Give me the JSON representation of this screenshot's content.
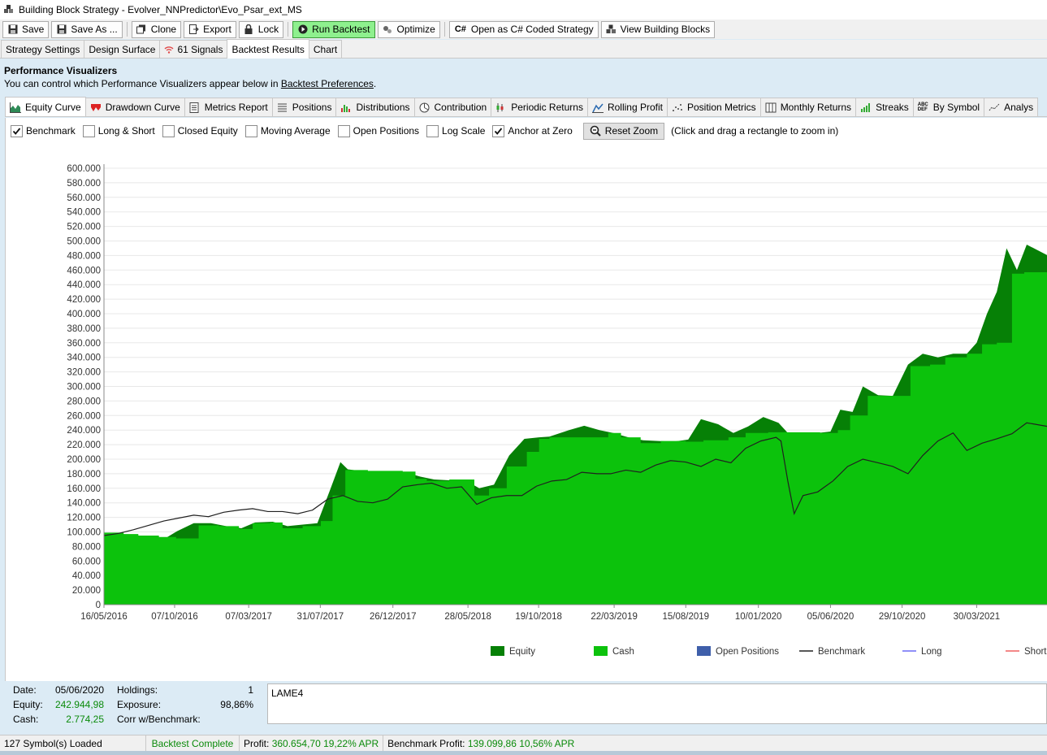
{
  "window": {
    "title": "Building Block Strategy - Evolver_NNPredictor\\Evo_Psar_ext_MS"
  },
  "toolbar": {
    "save": "Save",
    "save_as": "Save As ...",
    "clone": "Clone",
    "export": "Export",
    "lock": "Lock",
    "run_backtest": "Run Backtest",
    "optimize": "Optimize",
    "open_csharp": "Open as C# Coded Strategy",
    "view_blocks": "View Building Blocks"
  },
  "tabs": {
    "strategy_settings": "Strategy Settings",
    "design_surface": "Design Surface",
    "signals": "61 Signals",
    "backtest_results": "Backtest Results",
    "chart": "Chart"
  },
  "perf": {
    "heading": "Performance Visualizers",
    "sub_prefix": "You can control which Performance Visualizers appear below in ",
    "sub_link": "Backtest Preferences",
    "sub_suffix": "."
  },
  "visualizers": {
    "equity_curve": "Equity Curve",
    "drawdown_curve": "Drawdown Curve",
    "metrics_report": "Metrics Report",
    "positions": "Positions",
    "distributions": "Distributions",
    "contribution": "Contribution",
    "periodic_returns": "Periodic Returns",
    "rolling_profit": "Rolling Profit",
    "position_metrics": "Position Metrics",
    "monthly_returns": "Monthly Returns",
    "streaks": "Streaks",
    "by_symbol": "By Symbol",
    "analysis": "Analys"
  },
  "options": {
    "benchmark": {
      "label": "Benchmark",
      "checked": true
    },
    "long_short": {
      "label": "Long & Short",
      "checked": false
    },
    "closed_equity": {
      "label": "Closed Equity",
      "checked": false
    },
    "moving_average": {
      "label": "Moving Average",
      "checked": false
    },
    "open_positions": {
      "label": "Open Positions",
      "checked": false
    },
    "log_scale": {
      "label": "Log Scale",
      "checked": false
    },
    "anchor_zero": {
      "label": "Anchor at Zero",
      "checked": true
    },
    "reset_zoom": "Reset Zoom",
    "zoom_hint": "(Click and drag a rectangle to zoom in)"
  },
  "chart_data": {
    "type": "area",
    "title": "",
    "xlabel": "",
    "ylabel": "",
    "ylim": [
      0,
      600000
    ],
    "y_ticks": [
      "0",
      "20.000",
      "40.000",
      "60.000",
      "80.000",
      "100.000",
      "120.000",
      "140.000",
      "160.000",
      "180.000",
      "200.000",
      "220.000",
      "240.000",
      "260.000",
      "280.000",
      "300.000",
      "320.000",
      "340.000",
      "360.000",
      "380.000",
      "400.000",
      "420.000",
      "440.000",
      "460.000",
      "480.000",
      "500.000",
      "520.000",
      "540.000",
      "560.000",
      "580.000",
      "600.000"
    ],
    "x_ticks": [
      "16/05/2016",
      "07/10/2016",
      "07/03/2017",
      "31/07/2017",
      "26/12/2017",
      "28/05/2018",
      "19/10/2018",
      "22/03/2019",
      "15/08/2019",
      "10/01/2020",
      "05/06/2020",
      "29/10/2020",
      "30/03/2021"
    ],
    "x_start": "2016-05-16",
    "x_end": "2021-08-22",
    "legend_position": "bottom",
    "legend": [
      "Equity",
      "Cash",
      "Open Positions",
      "Benchmark",
      "Long",
      "Short"
    ],
    "colors": {
      "equity": "#068006",
      "cash": "#0cc20c",
      "open_positions": "#3f5faa",
      "benchmark": "#202020",
      "long": "#6b6bf5",
      "short": "#f06060",
      "grid": "#e8e8e8"
    },
    "series": [
      {
        "name": "Cash",
        "x": [
          "2016-05-16",
          "2016-06-25",
          "2016-07-25",
          "2016-09-05",
          "2016-10-10",
          "2016-11-25",
          "2017-01-05",
          "2017-02-15",
          "2017-03-15",
          "2017-04-20",
          "2017-05-15",
          "2017-06-25",
          "2017-08-01",
          "2017-08-25",
          "2017-09-20",
          "2017-11-05",
          "2018-01-15",
          "2018-02-10",
          "2018-03-05",
          "2018-04-20",
          "2018-06-10",
          "2018-07-10",
          "2018-08-15",
          "2018-09-25",
          "2018-10-20",
          "2018-11-10",
          "2019-01-05",
          "2019-02-15",
          "2019-03-10",
          "2019-04-05",
          "2019-05-15",
          "2019-06-25",
          "2019-08-15",
          "2019-09-20",
          "2019-11-10",
          "2019-12-15",
          "2020-01-30",
          "2020-03-05",
          "2020-05-15",
          "2020-06-20",
          "2020-07-15",
          "2020-08-20",
          "2020-10-20",
          "2020-11-15",
          "2020-12-25",
          "2021-01-25",
          "2021-03-10",
          "2021-04-10",
          "2021-05-10",
          "2021-06-10",
          "2021-07-05",
          "2021-08-22"
        ],
        "values": [
          99000,
          97000,
          95000,
          93000,
          91000,
          109000,
          108000,
          104000,
          112000,
          113000,
          105000,
          108000,
          115000,
          150000,
          185000,
          184000,
          183000,
          173000,
          170000,
          172000,
          150000,
          160000,
          190000,
          210000,
          228000,
          230000,
          230000,
          230000,
          236000,
          230000,
          222000,
          225000,
          224000,
          226000,
          230000,
          236000,
          237000,
          237000,
          236000,
          240000,
          260000,
          287000,
          287000,
          328000,
          330000,
          340000,
          345000,
          358000,
          360000,
          455000,
          457000,
          478000
        ]
      },
      {
        "name": "Equity",
        "x": [
          "2016-05-16",
          "2016-06-10",
          "2016-07-15",
          "2016-08-20",
          "2016-09-20",
          "2016-10-12",
          "2016-11-15",
          "2016-12-20",
          "2017-01-20",
          "2017-02-20",
          "2017-03-20",
          "2017-04-25",
          "2017-05-25",
          "2017-06-25",
          "2017-07-25",
          "2017-08-20",
          "2017-09-10",
          "2017-09-25",
          "2017-10-20",
          "2017-11-20",
          "2017-12-20",
          "2018-01-20",
          "2018-02-20",
          "2018-03-20",
          "2018-04-20",
          "2018-05-20",
          "2018-06-20",
          "2018-07-20",
          "2018-08-20",
          "2018-09-20",
          "2018-10-20",
          "2018-11-10",
          "2018-12-20",
          "2019-01-20",
          "2019-02-20",
          "2019-03-20",
          "2019-04-20",
          "2019-05-20",
          "2019-06-20",
          "2019-07-20",
          "2019-08-20",
          "2019-09-15",
          "2019-10-20",
          "2019-11-20",
          "2019-12-20",
          "2020-01-20",
          "2020-02-20",
          "2020-03-10",
          "2020-04-10",
          "2020-05-10",
          "2020-06-05",
          "2020-06-25",
          "2020-07-20",
          "2020-08-10",
          "2020-09-10",
          "2020-10-10",
          "2020-11-10",
          "2020-12-10",
          "2021-01-10",
          "2021-02-10",
          "2021-03-10",
          "2021-03-30",
          "2021-04-20",
          "2021-05-10",
          "2021-05-30",
          "2021-06-20",
          "2021-07-10",
          "2021-08-22"
        ],
        "values": [
          99000,
          97500,
          96000,
          93000,
          92000,
          101000,
          112000,
          112000,
          108000,
          105000,
          113000,
          114000,
          108000,
          110000,
          112000,
          158000,
          196000,
          186000,
          184000,
          182000,
          183000,
          182000,
          176000,
          172000,
          171000,
          172000,
          160000,
          165000,
          205000,
          228000,
          230000,
          231000,
          240000,
          246000,
          240000,
          236000,
          230000,
          226000,
          225000,
          224000,
          227000,
          255000,
          248000,
          236000,
          245000,
          258000,
          250000,
          236000,
          236000,
          236000,
          238000,
          268000,
          265000,
          300000,
          288000,
          287000,
          330000,
          345000,
          340000,
          345000,
          345000,
          360000,
          400000,
          430000,
          490000,
          460000,
          495000,
          480000
        ]
      },
      {
        "name": "Benchmark",
        "x": [
          "2016-05-16",
          "2016-06-15",
          "2016-07-15",
          "2016-08-15",
          "2016-09-15",
          "2016-10-15",
          "2016-11-15",
          "2016-12-15",
          "2017-01-15",
          "2017-02-15",
          "2017-03-15",
          "2017-04-15",
          "2017-05-15",
          "2017-06-15",
          "2017-07-15",
          "2017-08-15",
          "2017-09-15",
          "2017-10-15",
          "2017-11-15",
          "2017-12-15",
          "2018-01-15",
          "2018-02-15",
          "2018-03-15",
          "2018-04-15",
          "2018-05-15",
          "2018-06-15",
          "2018-07-15",
          "2018-08-15",
          "2018-09-15",
          "2018-10-15",
          "2018-11-15",
          "2018-12-15",
          "2019-01-15",
          "2019-02-15",
          "2019-03-15",
          "2019-04-15",
          "2019-05-15",
          "2019-06-15",
          "2019-07-15",
          "2019-08-15",
          "2019-09-15",
          "2019-10-15",
          "2019-11-15",
          "2019-12-15",
          "2020-01-15",
          "2020-02-15",
          "2020-02-25",
          "2020-03-10",
          "2020-03-23",
          "2020-04-10",
          "2020-05-10",
          "2020-06-10",
          "2020-07-10",
          "2020-08-10",
          "2020-09-10",
          "2020-10-10",
          "2020-11-10",
          "2020-12-10",
          "2021-01-10",
          "2021-02-10",
          "2021-03-10",
          "2021-04-10",
          "2021-05-10",
          "2021-06-10",
          "2021-07-10",
          "2021-08-22"
        ],
        "values": [
          95000,
          98000,
          103000,
          109000,
          115000,
          119000,
          123000,
          121000,
          127000,
          130000,
          132000,
          128000,
          128000,
          125000,
          130000,
          145000,
          150000,
          142000,
          140000,
          145000,
          162000,
          165000,
          167000,
          160000,
          162000,
          138000,
          147000,
          150000,
          150000,
          163000,
          170000,
          172000,
          182000,
          180000,
          180000,
          185000,
          182000,
          192000,
          198000,
          196000,
          190000,
          200000,
          195000,
          215000,
          225000,
          230000,
          225000,
          170000,
          125000,
          150000,
          155000,
          170000,
          190000,
          200000,
          195000,
          190000,
          180000,
          205000,
          225000,
          236000,
          212000,
          222000,
          228000,
          235000,
          250000,
          245000
        ]
      }
    ]
  },
  "info": {
    "date_label": "Date:",
    "date_value": "05/06/2020",
    "holdings_label": "Holdings:",
    "holdings_value": "1",
    "equity_label": "Equity:",
    "equity_value": "242.944,98",
    "exposure_label": "Exposure:",
    "exposure_value": "98,86%",
    "cash_label": "Cash:",
    "cash_value": "2.774,25",
    "corr_label": "Corr w/Benchmark:",
    "symbol": "LAME4"
  },
  "status": {
    "symbols_loaded": "127 Symbol(s) Loaded",
    "backtest": "Backtest Complete",
    "profit_label": "Profit:",
    "profit_value": "360.654,70 19,22% APR",
    "benchmark_label": "Benchmark Profit:",
    "benchmark_value": "139.099,86 10,56% APR"
  }
}
